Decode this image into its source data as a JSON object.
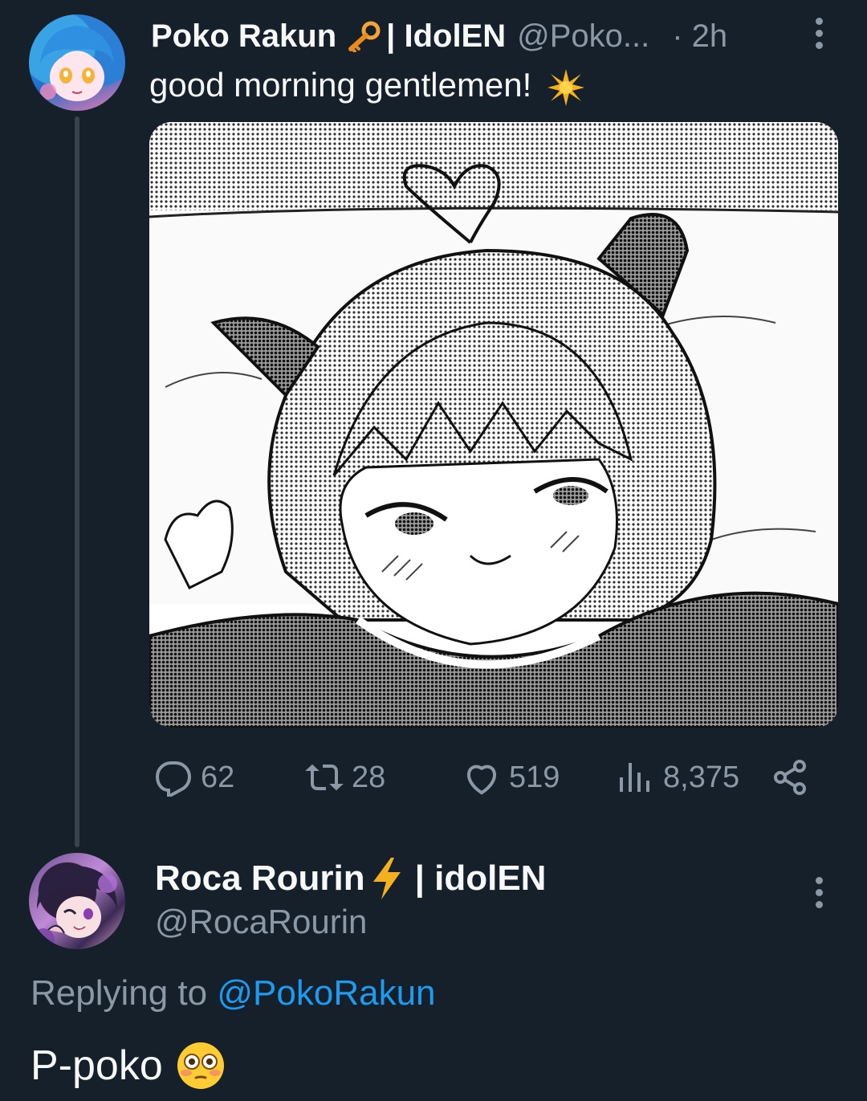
{
  "tweet": {
    "author_name": "Poko Rakun",
    "author_badge": "| IdolEN",
    "handle": "@Poko...",
    "time": "· 2h",
    "text": "good morning gentlemen!",
    "media_description": "manga-style illustration",
    "stats": {
      "replies": "62",
      "retweets": "28",
      "likes": "519",
      "views": "8,375"
    }
  },
  "reply": {
    "author_name": "Roca Rourin",
    "author_badge": "| idolEN",
    "handle": "@RocaRourin",
    "replying_prefix": "Replying to",
    "replying_handle": "@PokoRakun",
    "text": "P-poko"
  },
  "icons": {
    "key": "key-icon",
    "sparkle": "sparkle-icon",
    "bolt": "lightning-bolt-icon",
    "flushed": "flushed-face-emoji",
    "reply": "reply-icon",
    "retweet": "retweet-icon",
    "like": "heart-icon",
    "views": "views-chart-icon",
    "share": "share-icon",
    "more": "more-options-icon"
  },
  "colors": {
    "background": "#15202b",
    "text": "#f7f9f9",
    "muted": "#8b98a5",
    "link": "#1d9bf0",
    "thread_line": "#38444d"
  }
}
